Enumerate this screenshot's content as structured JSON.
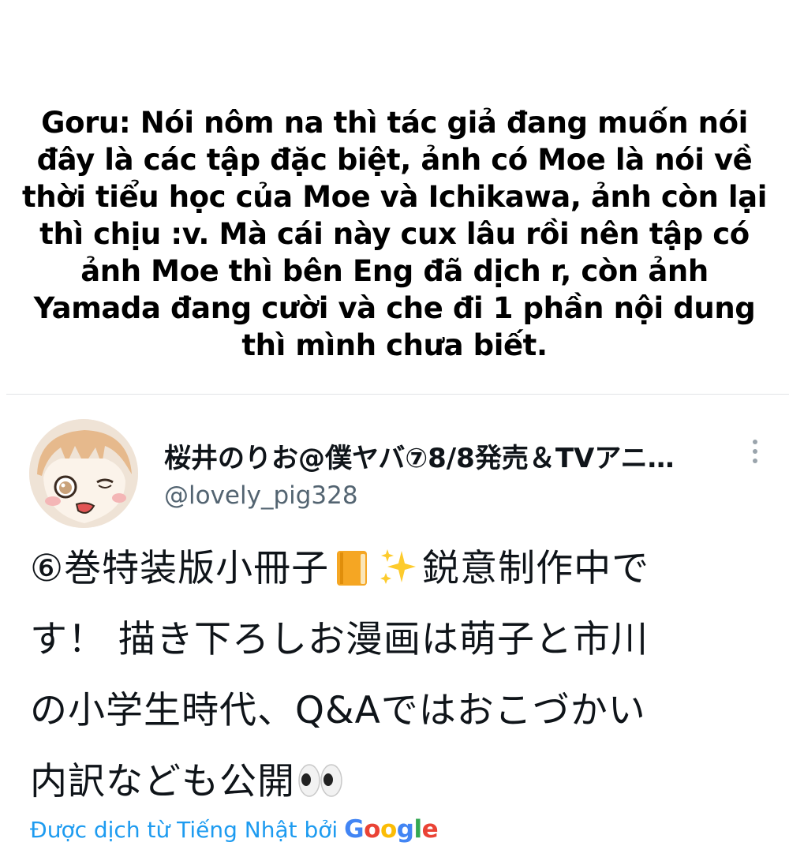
{
  "note": {
    "lines": [
      "Goru: Nói nôm na thì tác giả đang muốn nói",
      "đây là các tập đặc biệt, ảnh có Moe là nói về",
      "thời tiểu học của Moe và Ichikawa, ảnh còn lại",
      "thì chịu :v. Mà cái này cux lâu rồi nên tập có",
      "ảnh Moe thì bên Eng đã dịch r, còn ảnh",
      "Yamada đang cười và che đi 1 phần nội dung",
      "thì mình chưa biết."
    ]
  },
  "tweet": {
    "display_name": "桜井のりお@僕ヤバ⑦8/8発売＆TVアニ…",
    "handle": "@lovely_pig328",
    "body": {
      "line1_a": "⑥巻特装版小冊子",
      "line1_b": "鋭意制作中で",
      "line2": "す！ 描き下ろしお漫画は萌子と市川",
      "line3": "の小学生時代、Q&Aではおこづかい",
      "line4": "内訳なども公開"
    },
    "emojis": [
      "book-icon",
      "sparkles-icon",
      "eyes-icon"
    ],
    "translation": {
      "label": "Được dịch từ Tiếng Nhật bởi",
      "provider": [
        "G",
        "o",
        "o",
        "g",
        "l",
        "e"
      ]
    }
  },
  "colors": {
    "link": "#1d9bf0",
    "secondary_text": "#536471",
    "primary_text": "#0f1419",
    "divider": "#e1e4e6"
  }
}
